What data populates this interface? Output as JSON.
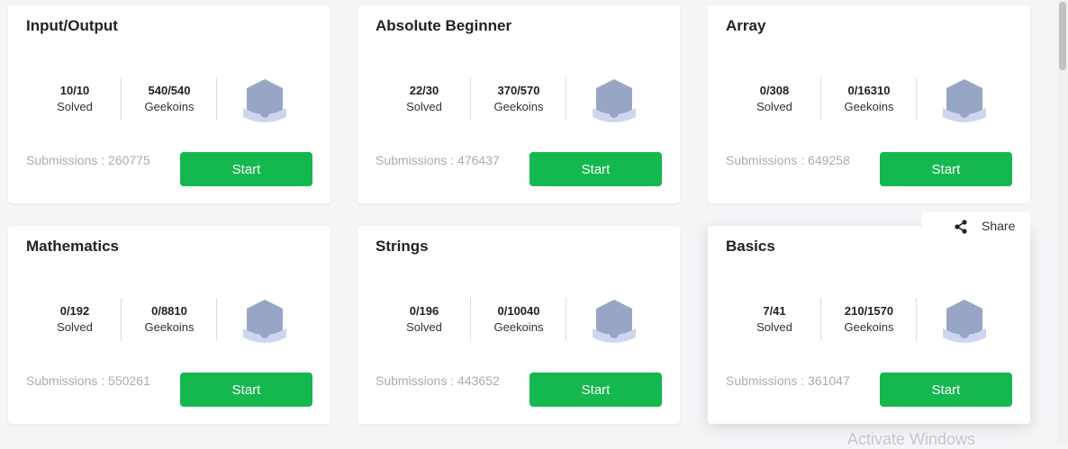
{
  "courses": [
    {
      "title": "Input/Output",
      "solved_value": "10/10",
      "solved_label": "Solved",
      "geekoins_value": "540/540",
      "geekoins_label": "Geekoins",
      "submissions": "Submissions : 260775",
      "start_label": "Start",
      "badge_icon": "shield-badge-icon"
    },
    {
      "title": "Absolute Beginner",
      "solved_value": "22/30",
      "solved_label": "Solved",
      "geekoins_value": "370/570",
      "geekoins_label": "Geekoins",
      "submissions": "Submissions : 476437",
      "start_label": "Start",
      "badge_icon": "shield-badge-icon"
    },
    {
      "title": "Array",
      "solved_value": "0/308",
      "solved_label": "Solved",
      "geekoins_value": "0/16310",
      "geekoins_label": "Geekoins",
      "submissions": "Submissions : 649258",
      "start_label": "Start",
      "badge_icon": "shield-badge-icon"
    },
    {
      "title": "Mathematics",
      "solved_value": "0/192",
      "solved_label": "Solved",
      "geekoins_value": "0/8810",
      "geekoins_label": "Geekoins",
      "submissions": "Submissions : 550261",
      "start_label": "Start",
      "badge_icon": "shield-badge-icon"
    },
    {
      "title": "Strings",
      "solved_value": "0/196",
      "solved_label": "Solved",
      "geekoins_value": "0/10040",
      "geekoins_label": "Geekoins",
      "submissions": "Submissions : 443652",
      "start_label": "Start",
      "badge_icon": "shield-badge-icon"
    },
    {
      "title": "Basics",
      "solved_value": "7/41",
      "solved_label": "Solved",
      "geekoins_value": "210/1570",
      "geekoins_label": "Geekoins",
      "submissions": "Submissions : 361047",
      "start_label": "Start",
      "badge_icon": "shield-badge-icon"
    }
  ],
  "share": {
    "label": "Share",
    "icon": "share-icon"
  },
  "watermark": "Activate Windows",
  "colors": {
    "start_button": "#14b84f",
    "badge": "#98a6c5",
    "badge_ribbon": "#cdd6ee",
    "muted_text": "#a7acb6",
    "background": "#f5f5f8"
  }
}
